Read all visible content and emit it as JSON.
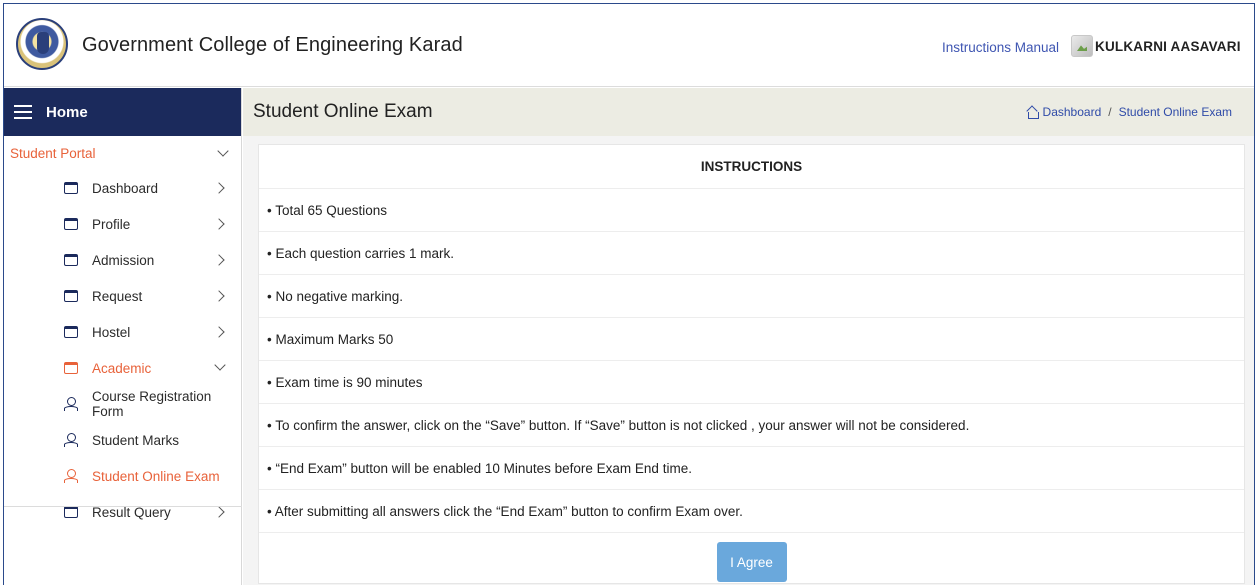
{
  "header": {
    "college_name": "Government College of Engineering Karad",
    "instructions_manual": "Instructions Manual",
    "user_name": "KULKARNI AASAVARI"
  },
  "sidebar": {
    "home": "Home",
    "portal": "Student Portal",
    "items": [
      {
        "label": "Dashboard",
        "icon": "folder-icon"
      },
      {
        "label": "Profile",
        "icon": "folder-icon"
      },
      {
        "label": "Admission",
        "icon": "folder-icon"
      },
      {
        "label": "Request",
        "icon": "folder-icon"
      },
      {
        "label": "Hostel",
        "icon": "folder-icon"
      },
      {
        "label": "Academic",
        "icon": "folder-icon"
      }
    ],
    "academic_sub": [
      {
        "label": "Course Registration Form",
        "icon": "user-icon"
      },
      {
        "label": "Student Marks",
        "icon": "user-icon"
      },
      {
        "label": "Student Online Exam",
        "icon": "user-icon"
      }
    ],
    "result_query": "Result Query"
  },
  "page": {
    "title": "Student Online Exam",
    "breadcrumb": {
      "home": "Dashboard",
      "current": "Student Online Exam"
    }
  },
  "instructions": {
    "title": "INSTRUCTIONS",
    "lines": [
      "• Total 65 Questions",
      "• Each question carries 1 mark.",
      "• No negative marking.",
      "• Maximum Marks 50",
      "• Exam time is 90 minutes",
      "• To confirm the answer, click on the “Save” button. If “Save” button is not clicked , your answer will not be considered.",
      "• “End Exam” button will be enabled 10 Minutes before Exam End time.",
      "• After submitting all answers click the “End Exam” button to confirm Exam over."
    ],
    "agree_label": "I Agree"
  },
  "colors": {
    "sidebar_header": "#1b2a5c",
    "accent_orange": "#e8623a",
    "link_blue": "#2f4ba8",
    "agree_button": "#6aa8dc"
  }
}
